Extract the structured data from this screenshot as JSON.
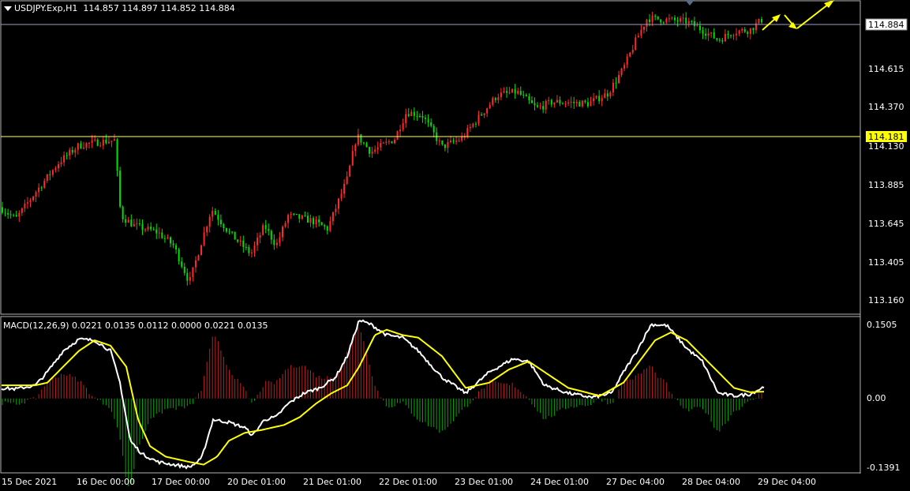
{
  "header": {
    "symbol": "USDJPY.Exp,H1",
    "ohlc": "114.857 114.897 114.852 114.884"
  },
  "colors": {
    "background": "#000000",
    "bull": "#ff2a2a",
    "bear": "#00e000",
    "grid": "#b4b4b4",
    "signal": "#ffff00",
    "macd_line": "#ffffff",
    "level_line": "#ffff80",
    "current_line": "#a0a0c0",
    "arrow": "#ffff00"
  },
  "price_scale": [
    "114.615",
    "114.370",
    "114.130",
    "113.885",
    "113.645",
    "113.405",
    "113.160"
  ],
  "current_price": "114.884",
  "level_price": "114.181",
  "macd": {
    "label": "MACD(12,26,9) 0.0221 0.0135 0.0112 0.0000 0.0221 0.0135",
    "scale": [
      "0.1505",
      "0.00",
      "-0.1391"
    ]
  },
  "time_axis": [
    "15 Dec 2021",
    "16 Dec 00:00",
    "17 Dec 00:00",
    "20 Dec 01:00",
    "21 Dec 01:00",
    "22 Dec 01:00",
    "23 Dec 01:00",
    "24 Dec 01:00",
    "27 Dec 04:00",
    "28 Dec 04:00",
    "29 Dec 04:00"
  ],
  "chart_data": {
    "type": "candlestick",
    "price_anchors": [
      [
        0,
        113.73
      ],
      [
        20,
        113.66
      ],
      [
        45,
        113.82
      ],
      [
        75,
        114.0
      ],
      [
        100,
        114.1
      ],
      [
        125,
        114.12
      ],
      [
        145,
        114.13
      ],
      [
        153,
        113.68
      ],
      [
        170,
        113.62
      ],
      [
        200,
        113.58
      ],
      [
        220,
        113.5
      ],
      [
        240,
        113.28
      ],
      [
        255,
        113.52
      ],
      [
        268,
        113.72
      ],
      [
        290,
        113.58
      ],
      [
        318,
        113.45
      ],
      [
        335,
        113.62
      ],
      [
        350,
        113.5
      ],
      [
        365,
        113.68
      ],
      [
        395,
        113.65
      ],
      [
        415,
        113.6
      ],
      [
        440,
        113.9
      ],
      [
        452,
        114.16
      ],
      [
        470,
        114.06
      ],
      [
        500,
        114.14
      ],
      [
        515,
        114.3
      ],
      [
        535,
        114.28
      ],
      [
        560,
        114.09
      ],
      [
        585,
        114.14
      ],
      [
        600,
        114.23
      ],
      [
        630,
        114.4
      ],
      [
        655,
        114.42
      ],
      [
        680,
        114.32
      ],
      [
        700,
        114.36
      ],
      [
        745,
        114.35
      ],
      [
        770,
        114.41
      ],
      [
        790,
        114.56
      ],
      [
        805,
        114.72
      ],
      [
        820,
        114.86
      ],
      [
        845,
        114.85
      ],
      [
        870,
        114.84
      ],
      [
        890,
        114.79
      ],
      [
        910,
        114.73
      ],
      [
        930,
        114.78
      ],
      [
        950,
        114.79
      ],
      [
        965,
        114.85
      ]
    ],
    "macd_anchors": [
      [
        0,
        0.02
      ],
      [
        20,
        0.018
      ],
      [
        45,
        0.025
      ],
      [
        60,
        0.05
      ],
      [
        80,
        0.09
      ],
      [
        100,
        0.112
      ],
      [
        120,
        0.11
      ],
      [
        140,
        0.09
      ],
      [
        152,
        0.03
      ],
      [
        165,
        -0.08
      ],
      [
        180,
        -0.105
      ],
      [
        200,
        -0.12
      ],
      [
        220,
        -0.125
      ],
      [
        240,
        -0.13
      ],
      [
        255,
        -0.115
      ],
      [
        270,
        -0.04
      ],
      [
        290,
        -0.045
      ],
      [
        310,
        -0.055
      ],
      [
        320,
        -0.07
      ],
      [
        335,
        -0.04
      ],
      [
        350,
        -0.035
      ],
      [
        365,
        -0.01
      ],
      [
        385,
        0.01
      ],
      [
        405,
        0.02
      ],
      [
        425,
        0.04
      ],
      [
        440,
        0.08
      ],
      [
        455,
        0.148
      ],
      [
        470,
        0.14
      ],
      [
        490,
        0.12
      ],
      [
        510,
        0.115
      ],
      [
        530,
        0.09
      ],
      [
        560,
        0.04
      ],
      [
        590,
        0.01
      ],
      [
        620,
        0.05
      ],
      [
        650,
        0.075
      ],
      [
        670,
        0.07
      ],
      [
        690,
        0.025
      ],
      [
        720,
        0.01
      ],
      [
        750,
        0.002
      ],
      [
        775,
        0.01
      ],
      [
        790,
        0.05
      ],
      [
        805,
        0.085
      ],
      [
        825,
        0.14
      ],
      [
        845,
        0.138
      ],
      [
        870,
        0.095
      ],
      [
        890,
        0.07
      ],
      [
        910,
        0.01
      ],
      [
        930,
        0.005
      ],
      [
        950,
        0.008
      ],
      [
        968,
        0.022
      ]
    ],
    "signal_anchors": [
      [
        0,
        0.025
      ],
      [
        20,
        0.025
      ],
      [
        45,
        0.025
      ],
      [
        60,
        0.03
      ],
      [
        80,
        0.06
      ],
      [
        100,
        0.09
      ],
      [
        120,
        0.11
      ],
      [
        140,
        0.1
      ],
      [
        160,
        0.06
      ],
      [
        175,
        -0.04
      ],
      [
        190,
        -0.09
      ],
      [
        210,
        -0.11
      ],
      [
        240,
        -0.12
      ],
      [
        258,
        -0.125
      ],
      [
        275,
        -0.11
      ],
      [
        290,
        -0.08
      ],
      [
        310,
        -0.065
      ],
      [
        330,
        -0.06
      ],
      [
        360,
        -0.05
      ],
      [
        380,
        -0.035
      ],
      [
        400,
        -0.01
      ],
      [
        420,
        0.01
      ],
      [
        440,
        0.025
      ],
      [
        455,
        0.06
      ],
      [
        475,
        0.12
      ],
      [
        490,
        0.13
      ],
      [
        510,
        0.12
      ],
      [
        530,
        0.115
      ],
      [
        560,
        0.08
      ],
      [
        590,
        0.02
      ],
      [
        620,
        0.03
      ],
      [
        645,
        0.055
      ],
      [
        670,
        0.07
      ],
      [
        690,
        0.05
      ],
      [
        720,
        0.02
      ],
      [
        760,
        0.005
      ],
      [
        790,
        0.03
      ],
      [
        810,
        0.07
      ],
      [
        830,
        0.11
      ],
      [
        850,
        0.125
      ],
      [
        870,
        0.11
      ],
      [
        890,
        0.08
      ],
      [
        910,
        0.05
      ],
      [
        930,
        0.02
      ],
      [
        950,
        0.012
      ],
      [
        968,
        0.013
      ]
    ],
    "x_labels": [
      "15 Dec 2021",
      "16 Dec 00:00",
      "17 Dec 00:00",
      "20 Dec 01:00",
      "21 Dec 01:00",
      "22 Dec 01:00",
      "23 Dec 01:00",
      "24 Dec 01:00",
      "27 Dec 04:00",
      "28 Dec 04:00",
      "29 Dec 04:00"
    ],
    "y_ticks": [
      114.615,
      114.37,
      114.13,
      113.885,
      113.645,
      113.405,
      113.16
    ],
    "ylim": [
      113.1,
      114.95
    ],
    "macd_ylim": [
      -0.1391,
      0.1505
    ]
  }
}
